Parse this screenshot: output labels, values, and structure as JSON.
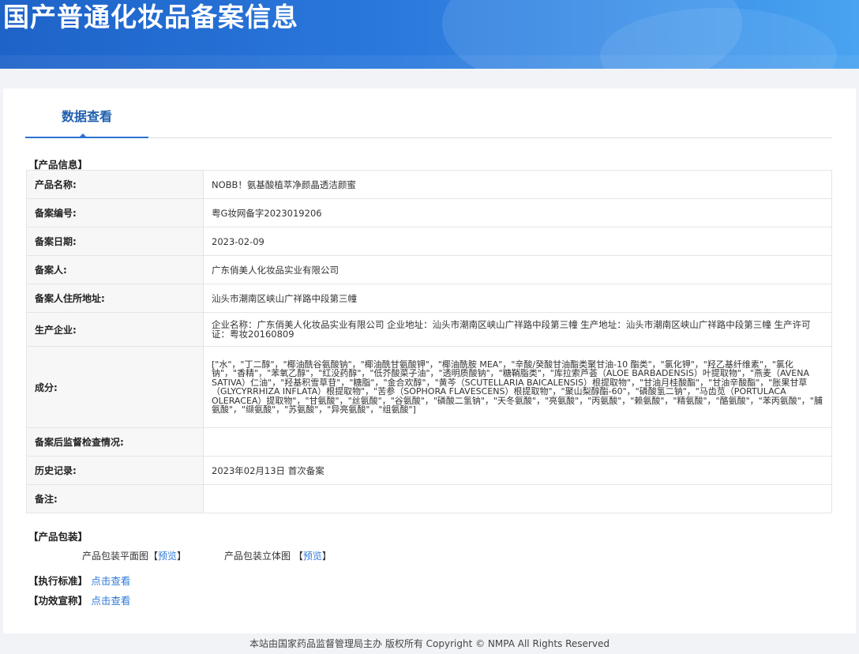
{
  "header": {
    "title": "国产普通化妆品备案信息"
  },
  "tabs": [
    {
      "label": "数据查看"
    }
  ],
  "product_info": {
    "section_title": "【产品信息】",
    "rows": [
      {
        "label": "产品名称:",
        "value": "NOBB！氨基酸植萃净颜晶透洁颜蜜"
      },
      {
        "label": "备案编号:",
        "value": "粤G妆网备字2023019206"
      },
      {
        "label": "备案日期:",
        "value": "2023-02-09"
      },
      {
        "label": "备案人:",
        "value": "广东俏美人化妆品实业有限公司"
      },
      {
        "label": "备案人住所地址:",
        "value": "汕头市潮南区峡山广祥路中段第三幢"
      },
      {
        "label": "生产企业:",
        "value": "企业名称：广东俏美人化妆品实业有限公司 企业地址：汕头市潮南区峡山广祥路中段第三幢 生产地址：汕头市潮南区峡山广祥路中段第三幢 生产许可证：粤妆20160809"
      },
      {
        "label": "成分:",
        "value": "[\"水\"，\"丁二醇\"，\"椰油酰谷氨酸钠\"，\"椰油酰甘氨酸钾\"，\"椰油酰胺 MEA\"，\"辛酸/癸酸甘油酯类聚甘油-10 酯类\"，\"氯化钾\"，\"羟乙基纤维素\"，\"氯化钠\"，\"香精\"，\"苯氧乙醇\"，\"红没药醇\"，\"低芥酸菜子油\"，\"透明质酸钠\"，\"糖鞘脂类\"，\"库拉索芦荟（ALOE BARBADENSIS）叶提取物\"，\"燕麦（AVENA SATIVA）仁油\"，\"羟基积雪草苷\"，\"糖脂\"，\"金合欢醇\"，\"黄芩（SCUTELLARIA BAICALENSIS）根提取物\"，\"甘油月桂酸酯\"，\"甘油辛酸酯\"，\"胀果甘草（GLYCYRRHIZA INFLATA）根提取物\"，\"苦参（SOPHORA FLAVESCENS）根提取物\"，\"聚山梨醇酯-60\"，\"磷酸氢二钠\"，\"马齿苋（PORTULACA OLERACEA）提取物\"，\"甘氨酸\"，\"丝氨酸\"，\"谷氨酸\"，\"磷酸二氢钠\"，\"天冬氨酸\"，\"亮氨酸\"，\"丙氨酸\"，\"赖氨酸\"，\"精氨酸\"，\"酪氨酸\"，\"苯丙氨酸\"，\"脯氨酸\"，\"缬氨酸\"，\"苏氨酸\"，\"异亮氨酸\"，\"组氨酸\"]"
      },
      {
        "label": "备案后监督检查情况:",
        "value": ""
      },
      {
        "label": "历史记录:",
        "value": "2023年02月13日 首次备案"
      },
      {
        "label": "备注:",
        "value": ""
      }
    ]
  },
  "packaging": {
    "section_title": "【产品包装】",
    "flat_label": "产品包装平面图",
    "solid_label": "产品包装立体图",
    "preview_link": "预览",
    "bracket_open": "【",
    "bracket_close": "】"
  },
  "standard": {
    "label": "【执行标准】",
    "link": "点击查看"
  },
  "efficacy": {
    "label": "【功效宣称】",
    "link": "点击查看"
  },
  "footer": {
    "text": "本站由国家药品监督管理局主办 版权所有 Copyright © NMPA All Rights Reserved"
  }
}
